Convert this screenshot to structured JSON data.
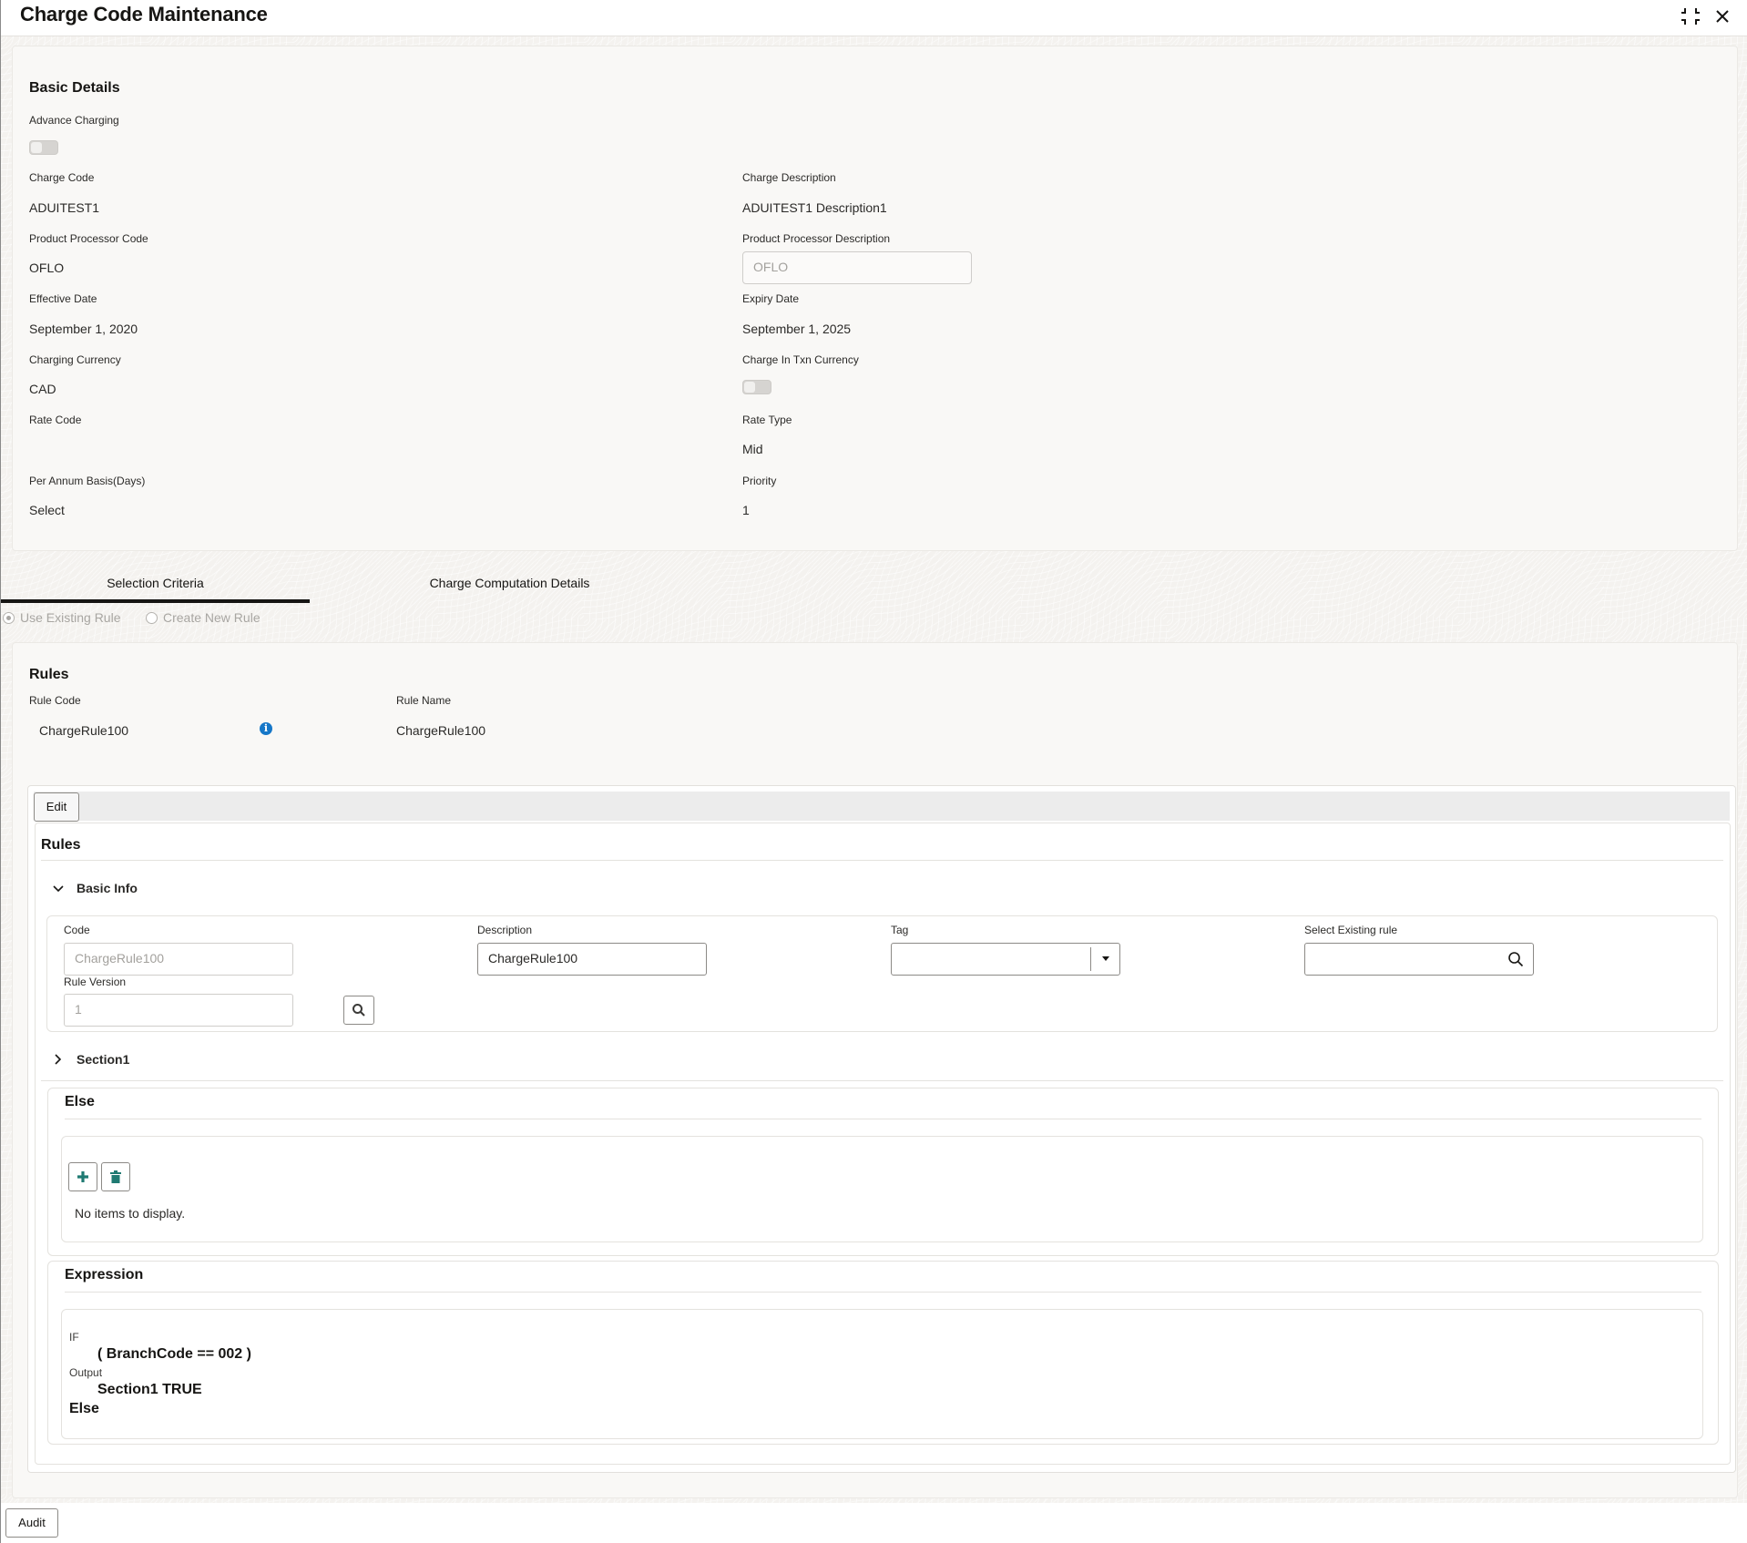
{
  "header": {
    "title": "Charge Code Maintenance",
    "collapse_icon": "collapse-icon",
    "close_icon": "close-icon"
  },
  "basic_details": {
    "title": "Basic Details",
    "advance_charging": {
      "label": "Advance Charging",
      "value": false
    },
    "charge_code": {
      "label": "Charge Code",
      "value": "ADUITEST1"
    },
    "charge_description": {
      "label": "Charge Description",
      "value": "ADUITEST1 Description1"
    },
    "product_processor_code": {
      "label": "Product Processor Code",
      "value": "OFLO"
    },
    "product_processor_description": {
      "label": "Product Processor Description",
      "value": "OFLO"
    },
    "effective_date": {
      "label": "Effective Date",
      "value": "September 1, 2020"
    },
    "expiry_date": {
      "label": "Expiry Date",
      "value": "September 1, 2025"
    },
    "charging_currency": {
      "label": "Charging Currency",
      "value": "CAD"
    },
    "charge_in_txn_currency": {
      "label": "Charge In Txn Currency",
      "value": false
    },
    "rate_code": {
      "label": "Rate Code",
      "value": ""
    },
    "rate_type": {
      "label": "Rate Type",
      "value": "Mid"
    },
    "per_annum_basis": {
      "label": "Per Annum Basis(Days)",
      "value": "Select"
    },
    "priority": {
      "label": "Priority",
      "value": "1"
    }
  },
  "tabs": [
    {
      "label": "Selection Criteria",
      "active": true
    },
    {
      "label": "Charge Computation Details",
      "active": false
    }
  ],
  "rule_options": [
    {
      "label": "Use Existing Rule",
      "selected": true
    },
    {
      "label": "Create New Rule",
      "selected": false
    }
  ],
  "rules": {
    "title": "Rules",
    "rule_code_label": "Rule Code",
    "rule_code": "ChargeRule100",
    "rule_name_label": "Rule Name",
    "rule_name": "ChargeRule100",
    "info_icon": "info-icon"
  },
  "editor": {
    "edit_label": "Edit",
    "title": "Rules",
    "basic_info": {
      "title": "Basic Info",
      "expanded": true,
      "code_label": "Code",
      "code_value": "ChargeRule100",
      "description_label": "Description",
      "description_value": "ChargeRule100",
      "tag_label": "Tag",
      "tag_value": "",
      "select_existing_label": "Select Existing rule",
      "select_existing_value": "",
      "rule_version_label": "Rule Version",
      "rule_version_value": "1"
    },
    "section1": {
      "title": "Section1",
      "expanded": false
    },
    "else_card": {
      "title": "Else",
      "add_icon": "plus-icon",
      "delete_icon": "trash-icon",
      "empty_text": "No items to display."
    },
    "expression": {
      "title": "Expression",
      "if_label": "IF",
      "condition": "( BranchCode == 002 )",
      "output_label": "Output",
      "output_value": "Section1 TRUE",
      "else_label": "Else"
    }
  },
  "footer": {
    "audit_label": "Audit"
  },
  "colors": {
    "info_blue": "#1677c8",
    "teal_icon": "#1f7a72",
    "panel_bg": "#f9f8f6"
  }
}
